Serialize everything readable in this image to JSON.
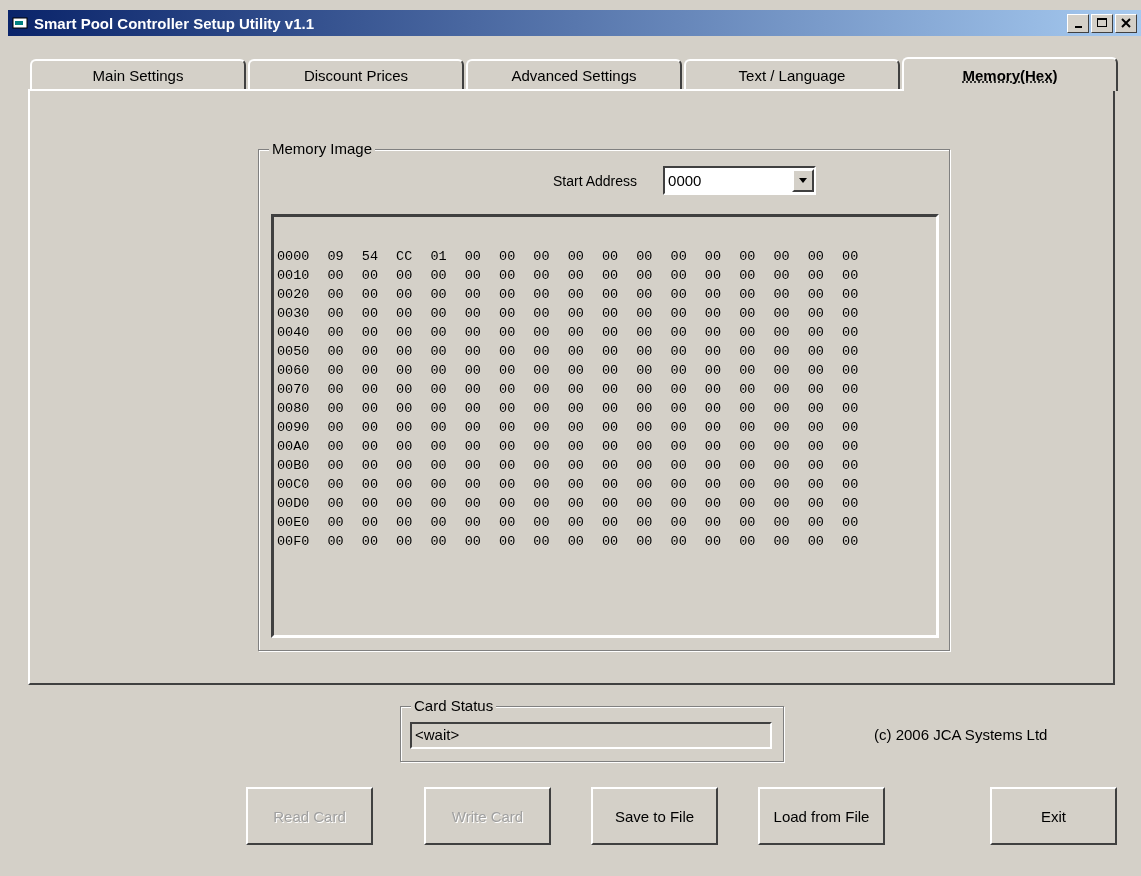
{
  "window": {
    "title": "Smart Pool Controller Setup Utility v1.1"
  },
  "tabs": [
    {
      "label": "Main Settings",
      "selected": false
    },
    {
      "label": "Discount Prices",
      "selected": false
    },
    {
      "label": "Advanced Settings",
      "selected": false
    },
    {
      "label": "Text / Language",
      "selected": false
    },
    {
      "label": "Memory(Hex)",
      "selected": true
    }
  ],
  "memory_image": {
    "title": "Memory Image",
    "start_address_label": "Start Address",
    "start_address_value": "0000",
    "lines": [
      "0000 09 54 CC 01 00 00 00 00 00 00 00 00 00 00 00 00",
      "0010 00 00 00 00 00 00 00 00 00 00 00 00 00 00 00 00",
      "0020 00 00 00 00 00 00 00 00 00 00 00 00 00 00 00 00",
      "0030 00 00 00 00 00 00 00 00 00 00 00 00 00 00 00 00",
      "0040 00 00 00 00 00 00 00 00 00 00 00 00 00 00 00 00",
      "0050 00 00 00 00 00 00 00 00 00 00 00 00 00 00 00 00",
      "0060 00 00 00 00 00 00 00 00 00 00 00 00 00 00 00 00",
      "0070 00 00 00 00 00 00 00 00 00 00 00 00 00 00 00 00",
      "0080 00 00 00 00 00 00 00 00 00 00 00 00 00 00 00 00",
      "0090 00 00 00 00 00 00 00 00 00 00 00 00 00 00 00 00",
      "00A0 00 00 00 00 00 00 00 00 00 00 00 00 00 00 00 00",
      "00B0 00 00 00 00 00 00 00 00 00 00 00 00 00 00 00 00",
      "00C0 00 00 00 00 00 00 00 00 00 00 00 00 00 00 00 00",
      "00D0 00 00 00 00 00 00 00 00 00 00 00 00 00 00 00 00",
      "00E0 00 00 00 00 00 00 00 00 00 00 00 00 00 00 00 00",
      "00F0 00 00 00 00 00 00 00 00 00 00 00 00 00 00 00 00"
    ]
  },
  "card_status": {
    "title": "Card Status",
    "value": "<wait>"
  },
  "copyright": "(c) 2006 JCA Systems Ltd",
  "buttons": [
    {
      "label": "Read Card",
      "disabled": true
    },
    {
      "label": "Write Card",
      "disabled": true
    },
    {
      "label": "Save to File",
      "disabled": false
    },
    {
      "label": "Load from File",
      "disabled": false
    },
    {
      "label": "Exit",
      "disabled": false
    }
  ]
}
